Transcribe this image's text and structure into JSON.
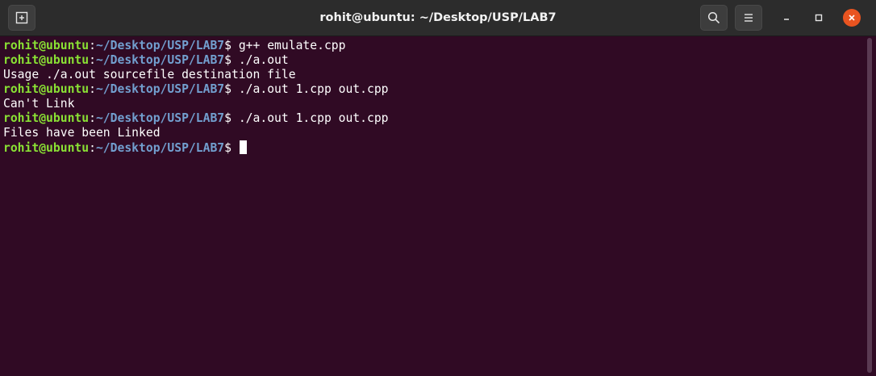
{
  "window": {
    "title": "rohit@ubuntu: ~/Desktop/USP/LAB7"
  },
  "titlebar": {
    "new_tab_icon": "new-tab-icon",
    "search_icon": "search-icon",
    "menu_icon": "hamburger-menu-icon",
    "minimize_icon": "minimize-icon",
    "maximize_icon": "maximize-icon",
    "close_icon": "close-icon"
  },
  "colors": {
    "background": "#300a24",
    "prompt_user": "#8ae234",
    "prompt_path": "#729fcf",
    "close_button": "#e95420"
  },
  "terminal": {
    "lines": [
      {
        "user": "rohit@ubuntu",
        "colon": ":",
        "path": "~/Desktop/USP/LAB7",
        "dollar": "$",
        "command": " g++ emulate.cpp"
      },
      {
        "user": "rohit@ubuntu",
        "colon": ":",
        "path": "~/Desktop/USP/LAB7",
        "dollar": "$",
        "command": " ./a.out"
      },
      {
        "output": "Usage ./a.out sourcefile destination file"
      },
      {
        "user": "rohit@ubuntu",
        "colon": ":",
        "path": "~/Desktop/USP/LAB7",
        "dollar": "$",
        "command": " ./a.out 1.cpp out.cpp"
      },
      {
        "output": "Can't Link"
      },
      {
        "user": "rohit@ubuntu",
        "colon": ":",
        "path": "~/Desktop/USP/LAB7",
        "dollar": "$",
        "command": " ./a.out 1.cpp out.cpp"
      },
      {
        "output": "Files have been Linked"
      },
      {
        "user": "rohit@ubuntu",
        "colon": ":",
        "path": "~/Desktop/USP/LAB7",
        "dollar": "$",
        "command": " "
      }
    ]
  }
}
